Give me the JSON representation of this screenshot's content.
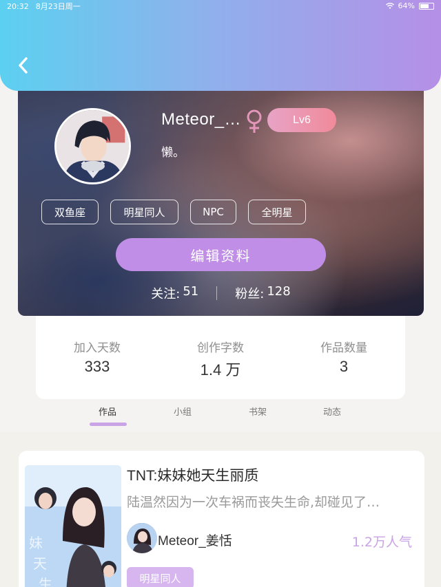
{
  "status_bar": {
    "time": "20:32",
    "date": "8月23日周一",
    "battery": "64%"
  },
  "header": {
    "back_icon": "chevron-left-icon"
  },
  "profile": {
    "username": "Meteor_…",
    "gender_icon": "female-icon",
    "level": "Lv6",
    "bio": "懒。",
    "tags": [
      "双鱼座",
      "明星同人",
      "NPC",
      "全明星"
    ],
    "edit_button": "编辑资料",
    "following_label": "关注:",
    "following_count": "51",
    "followers_label": "粉丝:",
    "followers_count": "128"
  },
  "stats": [
    {
      "label": "加入天数",
      "value": "333"
    },
    {
      "label": "创作字数",
      "value": "1.4 万"
    },
    {
      "label": "作品数量",
      "value": "3"
    }
  ],
  "tabs": [
    {
      "label": "作品",
      "active": true
    },
    {
      "label": "小组",
      "active": false
    },
    {
      "label": "书架",
      "active": false
    },
    {
      "label": "动态",
      "active": false
    }
  ],
  "works": [
    {
      "title": "TNT:妹妹她天生丽质",
      "summary": "陆温然因为一次车祸而丧失生命,却碰见了…",
      "author": "Meteor_姜恬",
      "popularity": "1.2万人气",
      "genre": "明星同人"
    }
  ],
  "colors": {
    "header_gradient_start": "#5cd0f0",
    "header_gradient_end": "#b58fe6",
    "accent_purple": "#c08ee6",
    "level_badge": "#f08a9a",
    "popularity": "#c9a3e6"
  }
}
